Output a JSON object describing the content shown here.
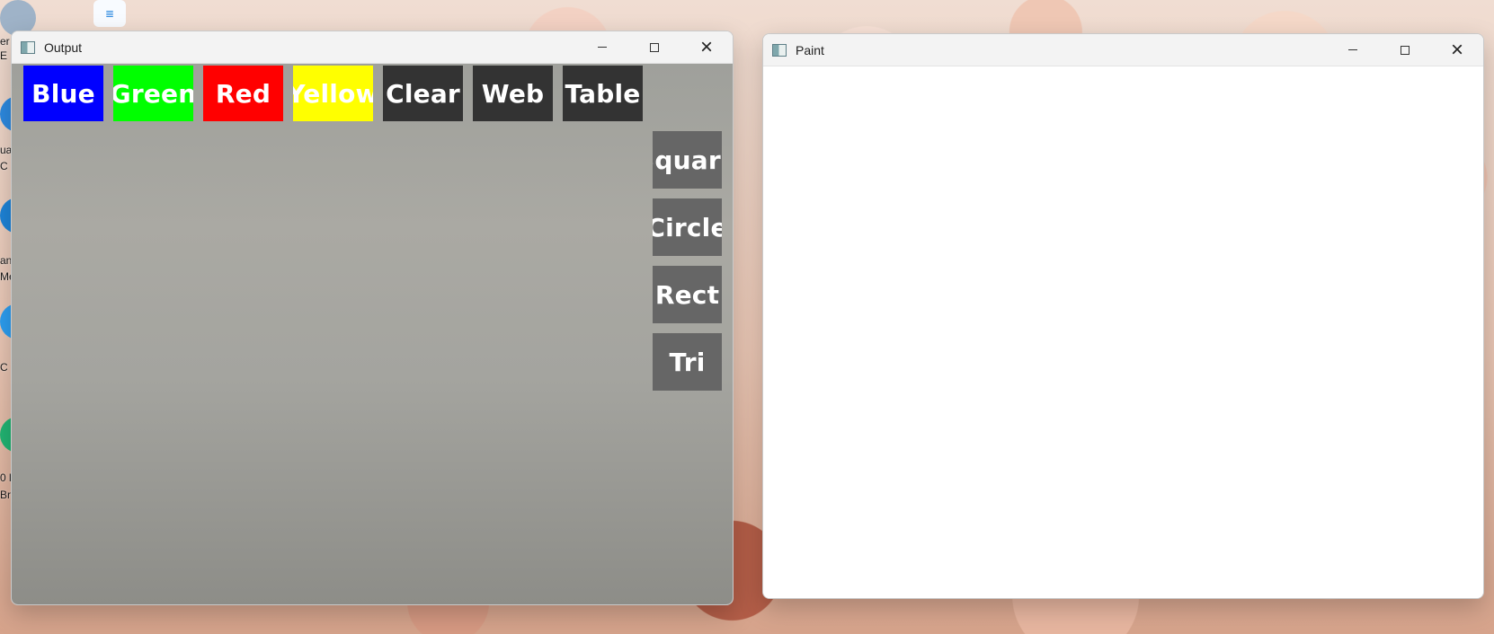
{
  "desktop": {
    "icons": [
      {
        "name": "user-icon",
        "label": "er"
      },
      {
        "name": "document-icon",
        "label": ""
      },
      {
        "name": "code-icon",
        "label": "ua"
      },
      {
        "name": "edge-icon",
        "label": "an"
      },
      {
        "name": "cortana-icon",
        "label": "C"
      },
      {
        "name": "teams-icon",
        "label": "0 l"
      }
    ],
    "labels": [
      "E",
      "C",
      "Me",
      "C",
      "0 l",
      "Br"
    ]
  },
  "windows": {
    "output": {
      "title": "Output",
      "colorButtons": [
        {
          "label": "Blue",
          "color": "#0000ff",
          "textColor": "#ffffff"
        },
        {
          "label": "Green",
          "color": "#00ff00",
          "textColor": "#ffffff"
        },
        {
          "label": "Red",
          "color": "#ff0000",
          "textColor": "#ffffff"
        },
        {
          "label": "Yellow",
          "color": "#ffff00",
          "textColor": "#ffffff"
        },
        {
          "label": "Clear",
          "color": "#333333",
          "textColor": "#ffffff"
        },
        {
          "label": "Web",
          "color": "#333333",
          "textColor": "#ffffff"
        },
        {
          "label": "Table",
          "color": "#333333",
          "textColor": "#ffffff"
        }
      ],
      "shapeButtons": [
        {
          "label": "Square",
          "color": "#666666"
        },
        {
          "label": "Circle",
          "color": "#666666"
        },
        {
          "label": "Rect",
          "color": "#666666"
        },
        {
          "label": "Tri",
          "color": "#666666"
        }
      ]
    },
    "paint": {
      "title": "Paint"
    }
  }
}
